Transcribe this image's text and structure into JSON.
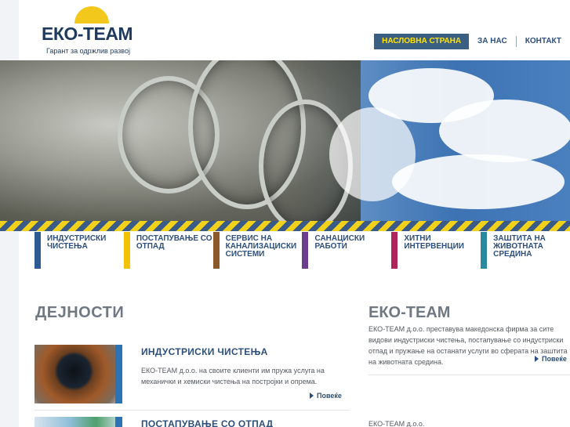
{
  "header": {
    "logo_name": "ЕКО-TEAM",
    "logo_tagline": "Гарант за одржлив развој"
  },
  "nav": {
    "items": [
      {
        "label": "НАСЛОВНА СТРАНА"
      },
      {
        "label": "ЗА НАС"
      },
      {
        "label": "КОНТАКТ"
      }
    ]
  },
  "services": [
    {
      "line1": "ИНДУСТРИСКИ",
      "line2": "ЧИСТЕЊА",
      "line3": "",
      "color": "#2c5a93"
    },
    {
      "line1": "ПОСТАПУВАЊЕ СО",
      "line2": "ОТПАД",
      "line3": "",
      "color": "#f2c200"
    },
    {
      "line1": "СЕРВИС НА",
      "line2": "КАНАЛИЗАЦИСКИ",
      "line3": "СИСТЕМИ",
      "color": "#8b5a2b"
    },
    {
      "line1": "САНАЦИСКИ",
      "line2": "РАБОТИ",
      "line3": "",
      "color": "#6b3d8f"
    },
    {
      "line1": "ХИТНИ",
      "line2": "ИНТЕРВЕНЦИИ",
      "line3": "",
      "color": "#b0245c"
    },
    {
      "line1": "ЗАШТИТА НА",
      "line2": "ЖИВОТНАТА",
      "line3": "СРЕДИНА",
      "color": "#2a8aa0"
    }
  ],
  "activities": {
    "title": "ДЕЈНОСТИ",
    "items": [
      {
        "title": "ИНДУСТРИСКИ ЧИСТЕЊА",
        "text": "ЕКО-TEAM д.о.о. на своите клиенти им пружа услуга на механички и хемиски чистења на постројки и опрема.",
        "more": "Повеќе"
      },
      {
        "title": "ПОСТАПУВАЊЕ СО ОТПАД",
        "text": "",
        "more": ""
      }
    ]
  },
  "about": {
    "title": "ЕКО-TEAM",
    "text": "ЕКО-TEAM д.о.о. преставува македонска фирма за сите видови индустриски чистења, постапување со индустриски отпад и пружање на останати услуги во сферата на заштита на животната средина.",
    "more": "Повеќе",
    "footer": "ЕКО-TEAM д.о.о."
  }
}
